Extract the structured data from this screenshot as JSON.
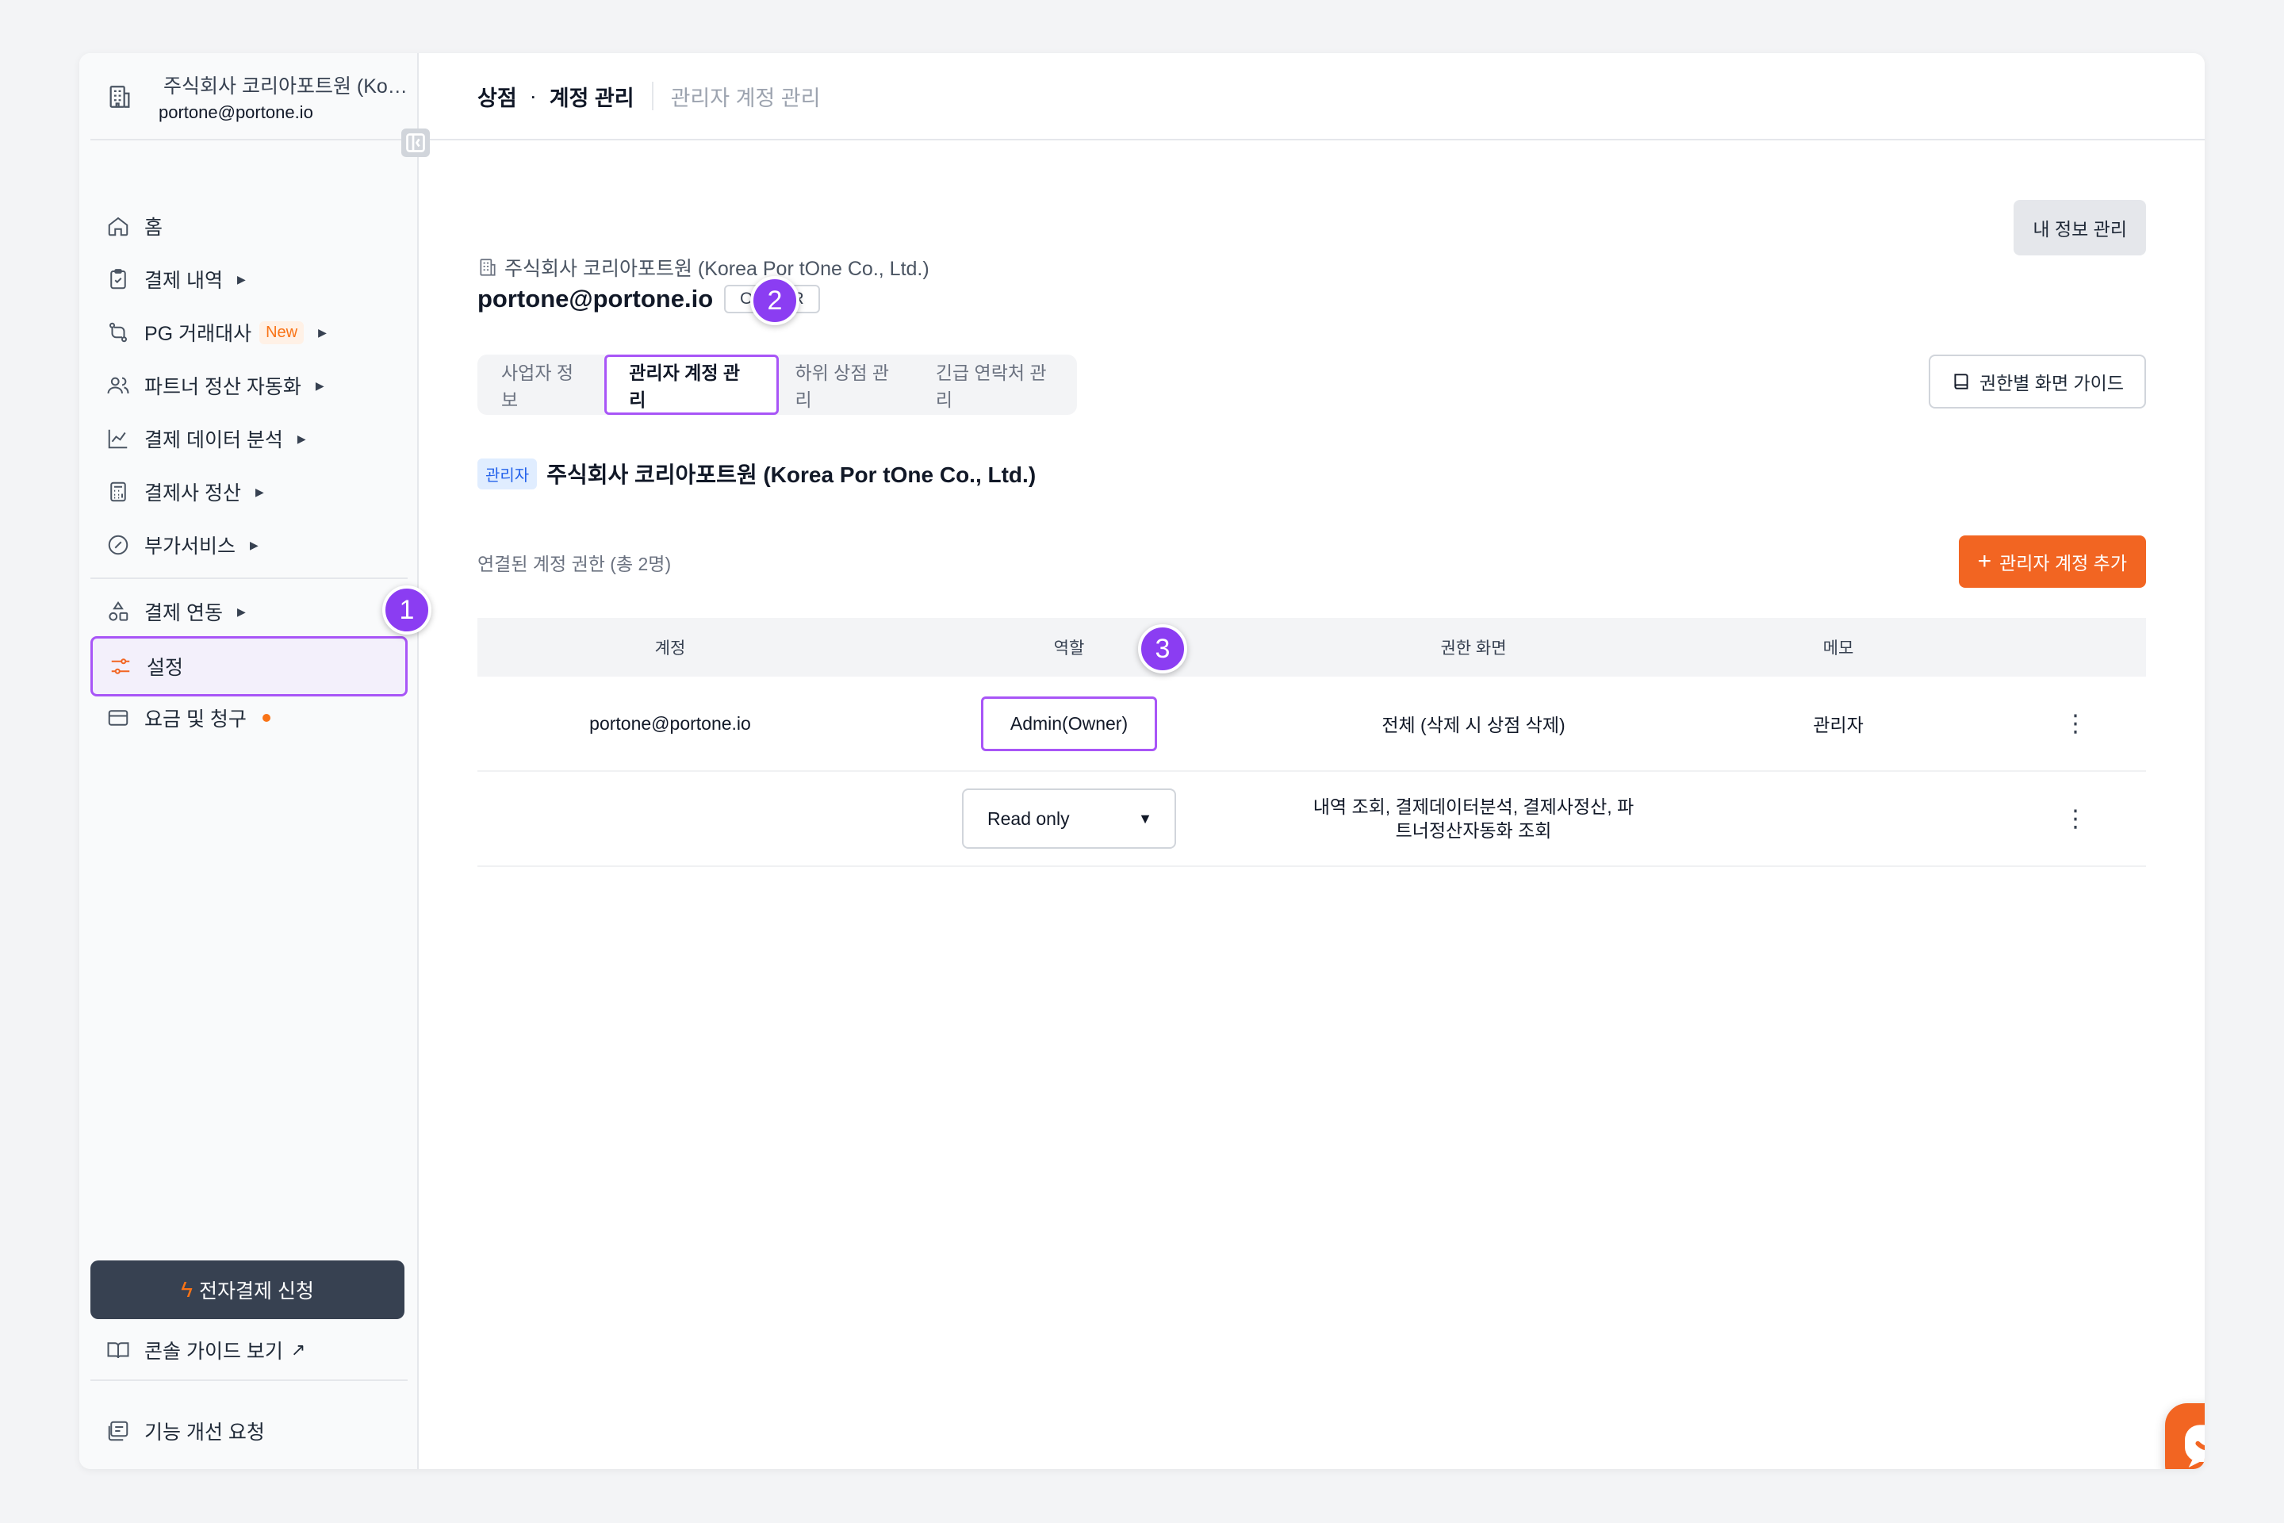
{
  "sidebar": {
    "org_name": "주식회사 코리아포트원 (Kore...",
    "org_email": "portone@portone.io",
    "items": [
      {
        "label": "홈"
      },
      {
        "label": "결제 내역"
      },
      {
        "label": "PG 거래대사",
        "badge": "New"
      },
      {
        "label": "파트너 정산 자동화"
      },
      {
        "label": "결제 데이터 분석"
      },
      {
        "label": "결제사 정산"
      },
      {
        "label": "부가서비스"
      },
      {
        "label": "결제 연동"
      },
      {
        "label": "설정"
      },
      {
        "label": "요금 및 청구"
      }
    ],
    "apply_button": "전자결제 신청",
    "guide_link": "콘솔 가이드 보기",
    "feedback": "기능 개선 요청"
  },
  "steps": [
    "1",
    "2",
    "3"
  ],
  "topbar": {
    "crumb_section": "상점",
    "crumb_dot": "·",
    "crumb_page": "계정 관리",
    "crumb_sub": "관리자 계정 관리"
  },
  "header": {
    "merchant_name": "주식회사 코리아포트원 (Korea Por tOne Co., Ltd.)",
    "account_email": "portone@portone.io",
    "owner_tag": "OWNER",
    "my_info_button": "내 정보 관리"
  },
  "tabs": [
    {
      "label": "사업자 정보"
    },
    {
      "label": "관리자 계정 관리"
    },
    {
      "label": "하위 상점 관리"
    },
    {
      "label": "긴급 연락처 관리"
    }
  ],
  "guide_button": "권한별 화면 가이드",
  "admin": {
    "tag": "관리자",
    "name": "주식회사 코리아포트원 (Korea Por tOne Co., Ltd.)"
  },
  "linked_label": "연결된 계정 권한 (총 2명)",
  "add_button": "관리자 계정 추가",
  "table": {
    "headers": [
      "계정",
      "역할",
      "권한 화면",
      "메모"
    ],
    "rows": [
      {
        "account": "portone@portone.io",
        "role": "Admin(Owner)",
        "permission": "전체 (삭제 시 상점 삭제)",
        "memo": "관리자"
      },
      {
        "account": "",
        "role": "Read only",
        "permission": "내역 조회, 결제데이터분석, 결제사정산, 파트너정산자동화 조회",
        "memo": ""
      }
    ],
    "more_icon": "⋮"
  },
  "colors": {
    "accent": "#f26522",
    "highlight": "#a855f7",
    "step_badge": "#8b3df2"
  }
}
